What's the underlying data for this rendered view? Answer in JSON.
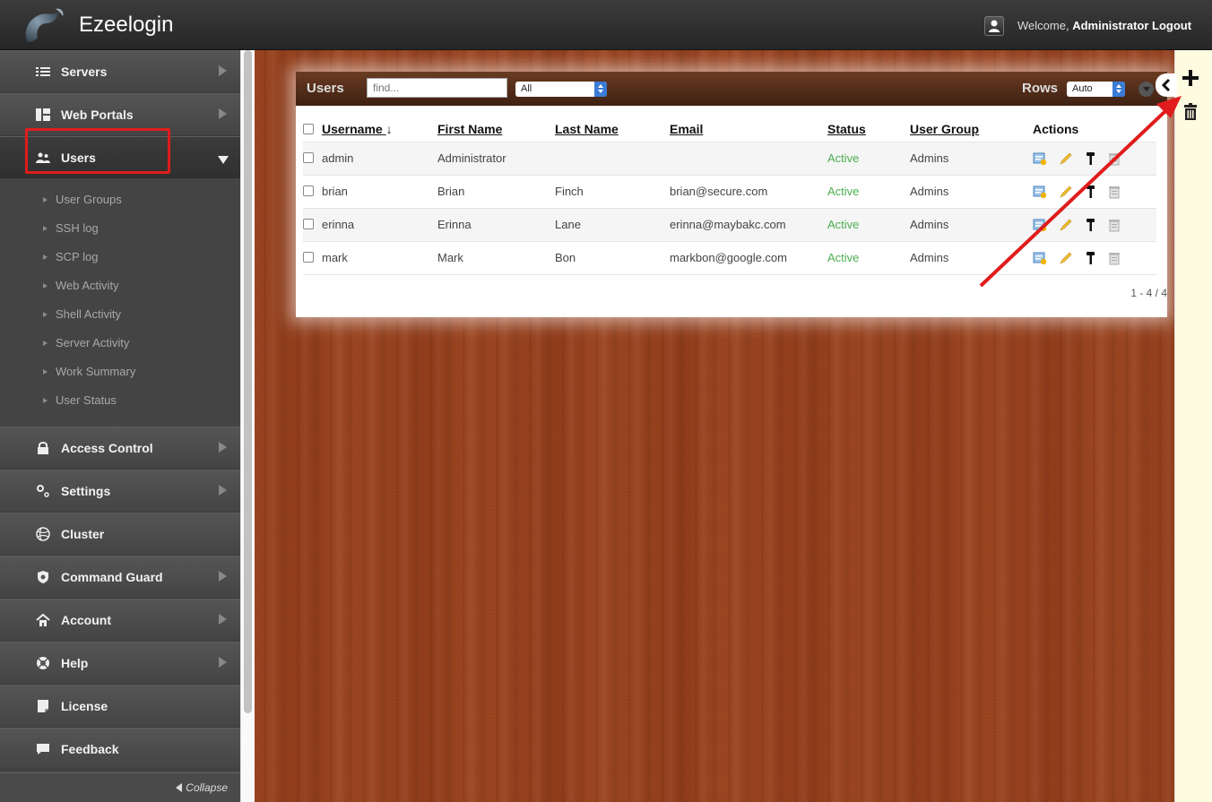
{
  "app": {
    "title": "Ezeelogin"
  },
  "header": {
    "welcome_prefix": "Welcome,",
    "username": "Administrator",
    "logout_label": "Logout"
  },
  "sidebar": {
    "items": [
      {
        "label": "Servers",
        "icon": "list-icon"
      },
      {
        "label": "Web Portals",
        "icon": "web-portals-icon"
      },
      {
        "label": "Users",
        "icon": "users-icon"
      },
      {
        "label": "Access Control",
        "icon": "lock-icon"
      },
      {
        "label": "Settings",
        "icon": "gears-icon"
      },
      {
        "label": "Cluster",
        "icon": "cluster-icon"
      },
      {
        "label": "Command Guard",
        "icon": "shield-icon"
      },
      {
        "label": "Account",
        "icon": "home-icon"
      },
      {
        "label": "Help",
        "icon": "lifebuoy-icon"
      },
      {
        "label": "License",
        "icon": "license-icon"
      },
      {
        "label": "Feedback",
        "icon": "chat-icon"
      }
    ],
    "sub_items": [
      "User Groups",
      "SSH log",
      "SCP log",
      "Web Activity",
      "Shell Activity",
      "Server Activity",
      "Work Summary",
      "User Status"
    ],
    "collapse_label": "Collapse"
  },
  "panel": {
    "title": "Users",
    "search_placeholder": "find...",
    "filter_value": "All",
    "rows_label": "Rows",
    "rows_value": "Auto",
    "columns": [
      "Username",
      "First Name",
      "Last Name",
      "Email",
      "Status",
      "User Group",
      "Actions"
    ],
    "rows": [
      {
        "username": "admin",
        "first_name": "Administrator",
        "last_name": "",
        "email": "",
        "status": "Active",
        "group": "Admins"
      },
      {
        "username": "brian",
        "first_name": "Brian",
        "last_name": "Finch",
        "email": "brian@secure.com",
        "status": "Active",
        "group": "Admins"
      },
      {
        "username": "erinna",
        "first_name": "Erinna",
        "last_name": "Lane",
        "email": "erinna@maybakc.com",
        "status": "Active",
        "group": "Admins"
      },
      {
        "username": "mark",
        "first_name": "Mark",
        "last_name": "Bon",
        "email": "markbon@google.com",
        "status": "Active",
        "group": "Admins"
      }
    ],
    "pager": "1 - 4 / 4"
  },
  "colors": {
    "accent_red": "#e01c1c",
    "status_active": "#4caf50",
    "select_blue": "#3a7bd5"
  }
}
